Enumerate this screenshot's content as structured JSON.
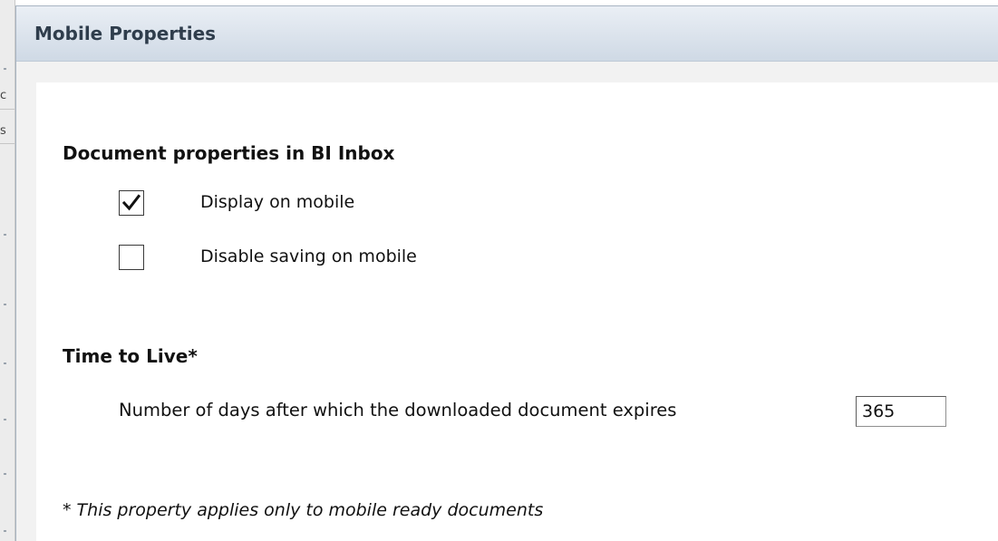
{
  "dialog": {
    "title": "Mobile Properties"
  },
  "background_fragments": {
    "frag_c": "c",
    "frag_s": "s"
  },
  "document_properties": {
    "heading": "Document properties in BI Inbox",
    "options": [
      {
        "label": "Display on mobile",
        "checked": true
      },
      {
        "label": "Disable saving on mobile",
        "checked": false
      }
    ]
  },
  "time_to_live": {
    "heading": "Time to Live*",
    "days_label": "Number of days after which the downloaded document expires",
    "days_value": "365"
  },
  "footnote": "* This property applies only to mobile ready documents",
  "icons": {
    "checkmark": "checkmark-icon"
  }
}
